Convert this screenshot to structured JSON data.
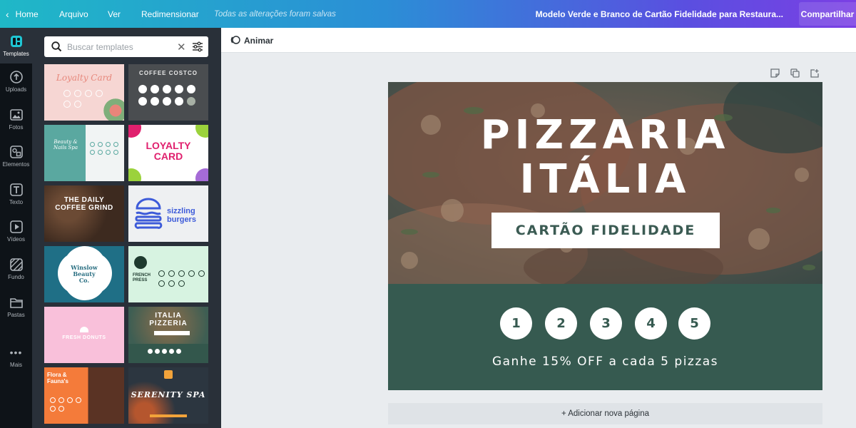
{
  "topbar": {
    "home": "Home",
    "file": "Arquivo",
    "view": "Ver",
    "resize": "Redimensionar",
    "saved_status": "Todas as alterações foram salvas",
    "document_title": "Modelo Verde e Branco de Cartão Fidelidade para Restaura...",
    "share": "Compartilhar"
  },
  "rail": {
    "items": [
      {
        "label": "Templates",
        "icon": "templates-icon"
      },
      {
        "label": "Uploads",
        "icon": "upload-icon"
      },
      {
        "label": "Fotos",
        "icon": "photo-icon"
      },
      {
        "label": "Elementos",
        "icon": "shapes-icon"
      },
      {
        "label": "Texto",
        "icon": "text-icon"
      },
      {
        "label": "Vídeos",
        "icon": "video-icon"
      },
      {
        "label": "Fundo",
        "icon": "background-icon"
      },
      {
        "label": "Pastas",
        "icon": "folder-icon"
      },
      {
        "label": "Mais",
        "icon": "more-icon"
      }
    ]
  },
  "search": {
    "placeholder": "Buscar templates"
  },
  "templates": [
    {
      "text": "Loyalty Card"
    },
    {
      "text": "COFFEE COSTCO"
    },
    {
      "text": "Beauty & Nails Spa"
    },
    {
      "text": "LOYALTY CARD"
    },
    {
      "text": "THE DAILY COFFEE GRIND"
    },
    {
      "text": "sizzling burgers"
    },
    {
      "text": "Winslow Beauty Co."
    },
    {
      "text": "FRENCH PRESS"
    },
    {
      "text": "FRESH DONUTS"
    },
    {
      "text": "ITALIA PIZZERIA"
    },
    {
      "text": "Flora & Fauna's"
    },
    {
      "text": "SERENITY SPA"
    }
  ],
  "editor": {
    "animate": "Animar",
    "add_page": "+ Adicionar nova página"
  },
  "card": {
    "title_line1": "PIZZARIA",
    "title_line2": "ITÁLIA",
    "banner": "CARTÃO FIDELIDADE",
    "stamps": [
      "1",
      "2",
      "3",
      "4",
      "5"
    ],
    "offer": "Ganhe 15% OFF a cada 5 pizzas",
    "colors": {
      "green": "#365a50",
      "white": "#ffffff"
    }
  }
}
